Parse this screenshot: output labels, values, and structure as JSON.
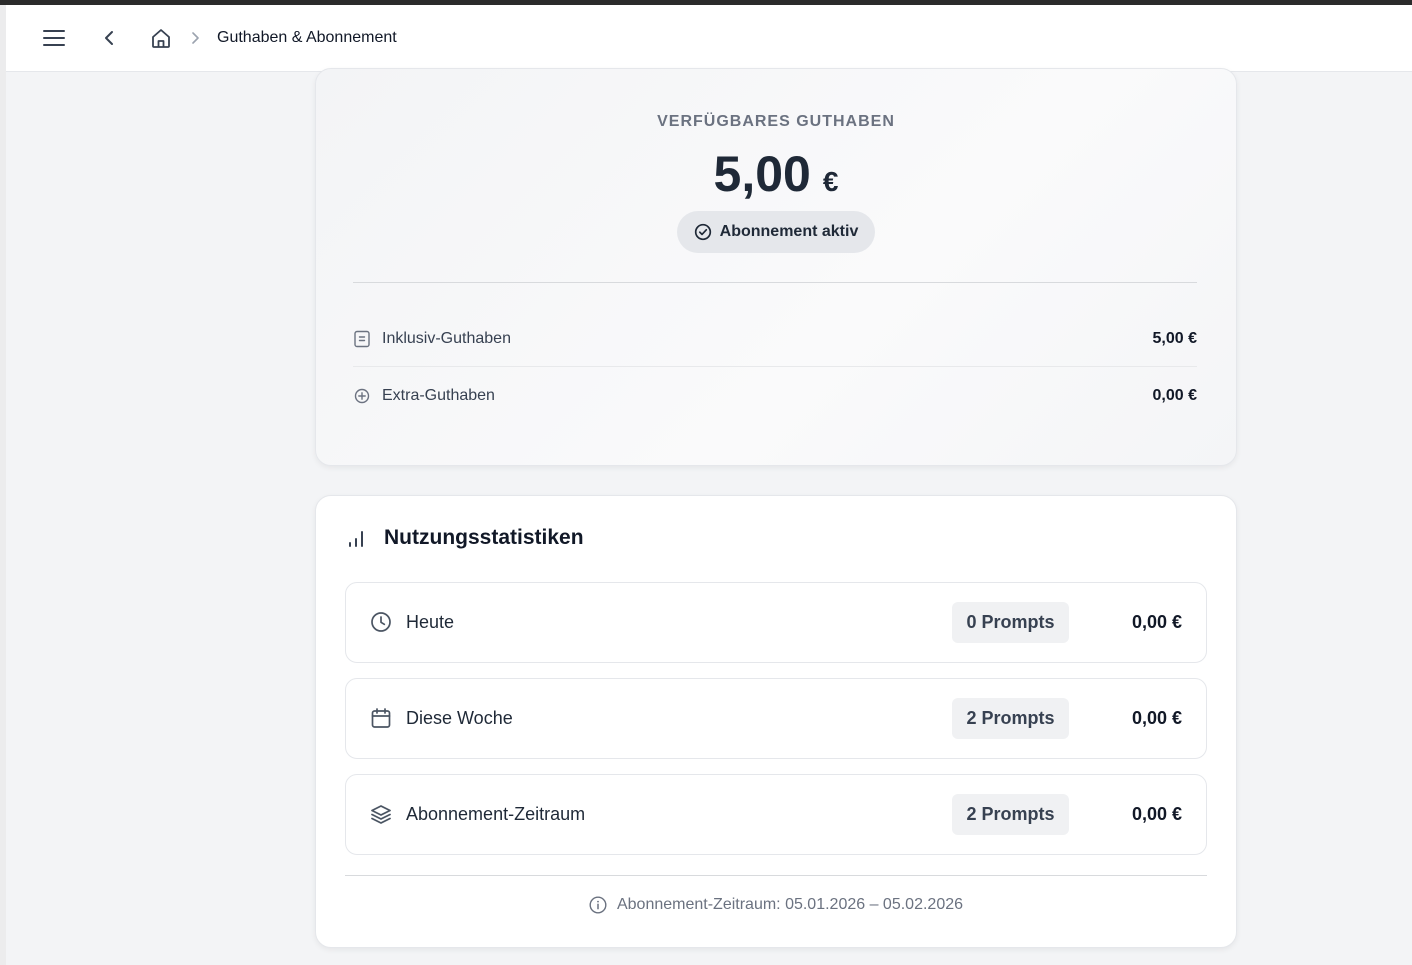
{
  "header": {
    "title": "Guthaben & Abonnement",
    "icons": [
      "menu-icon",
      "back-icon",
      "home-icon",
      "chevron-right-icon"
    ]
  },
  "balance": {
    "label": "VERFÜGBARES GUTHABEN",
    "amount": "5,00",
    "currency": "€",
    "status": "Abonnement aktiv",
    "rows": [
      {
        "label": "Inklusiv-Guthaben",
        "value": "5,00 €",
        "icon": "receipt-icon"
      },
      {
        "label": "Extra-Guthaben",
        "value": "0,00 €",
        "icon": "plus-circle-icon"
      }
    ]
  },
  "stats": {
    "title": "Nutzungsstatistiken",
    "rows": [
      {
        "label": "Heute",
        "prompts": "0 Prompts",
        "value": "0,00 €",
        "icon": "clock-icon"
      },
      {
        "label": "Diese Woche",
        "prompts": "2 Prompts",
        "value": "0,00 €",
        "icon": "calendar-icon"
      },
      {
        "label": "Abonnement-Zeitraum",
        "prompts": "2 Prompts",
        "value": "0,00 €",
        "icon": "layers-icon"
      }
    ],
    "footnote": "Abonnement-Zeitraum: 05.01.2026 – 05.02.2026"
  },
  "colors": {
    "text_dark": "#1f2937",
    "text_muted": "#6b7280",
    "border": "#e5e7eb",
    "background": "#f3f4f6"
  }
}
